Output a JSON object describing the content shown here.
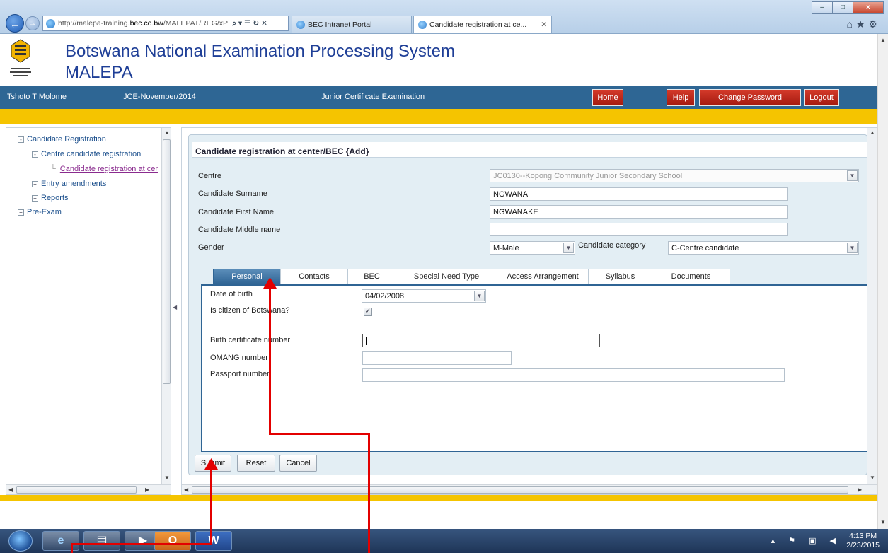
{
  "browser": {
    "url_prefix": "http://malepa-training.",
    "url_host": "bec.co.bw",
    "url_rest": "/MALEPAT/REG/xP",
    "url_tools": "⌕ ▾ ☰ ↻ ✕",
    "tabs": [
      {
        "label": "BEC Intranet Portal"
      },
      {
        "label": "Candidate registration at ce..."
      }
    ],
    "tab_close": "✕",
    "window_controls": {
      "minimize": "–",
      "maximize": "□",
      "close": "x"
    }
  },
  "header": {
    "title": "Botswana National Examination Processing System",
    "subtitle": "MALEPA"
  },
  "userbar": {
    "user_name": "Tshoto T Molome",
    "session": "JCE-November/2014",
    "exam": "Junior Certificate Examination",
    "home": "Home",
    "help": "Help",
    "change_password": "Change Password",
    "logout": "Logout"
  },
  "tree": {
    "items": [
      {
        "label": "Candidate Registration",
        "sign": "-"
      },
      {
        "label": "Centre candidate registration",
        "sign": "-"
      },
      {
        "label": "Candidate registration at cer"
      },
      {
        "label": "Entry amendments",
        "sign": "+"
      },
      {
        "label": "Reports",
        "sign": "+"
      },
      {
        "label": "Pre-Exam",
        "sign": "+"
      }
    ]
  },
  "form": {
    "title": "Candidate registration at center/BEC {Add}",
    "centre_label": "Centre",
    "centre_value": "JC0130--Kopong Community Junior Secondary School",
    "surname_label": "Candidate Surname",
    "surname_value": "NGWANA",
    "first_name_label": "Candidate First Name",
    "first_name_value": "NGWANAKE",
    "middle_name_label": "Candidate Middle name",
    "middle_name_value": "",
    "gender_label": "Gender",
    "gender_value": "M-Male",
    "category_label": "Candidate category",
    "category_value": "C-Centre candidate",
    "tabs": [
      "Personal",
      "Contacts",
      "BEC",
      "Special Need Type",
      "Access Arrangement",
      "Syllabus",
      "Documents"
    ],
    "personal": {
      "dob_label": "Date of birth",
      "dob_value": "04/02/2008",
      "citizen_label": "Is citizen of Botswana?",
      "citizen_checked": true,
      "birth_cert_label": "Birth certificate number",
      "birth_cert_value": "",
      "omang_label": "OMANG number",
      "omang_value": "",
      "passport_label": "Passport number",
      "passport_value": ""
    },
    "buttons": {
      "submit": "Submit",
      "reset": "Reset",
      "cancel": "Cancel"
    }
  },
  "taskbar": {
    "tray_icons": "▴ ⚑ ▣ ◀",
    "time": "4:13 PM",
    "date": "2/23/2015"
  },
  "colors": {
    "accent": "#2e6694",
    "title_blue": "#1f3f97",
    "yellow": "#f5c400",
    "danger": "#c62a1c",
    "annotation": "#e30000"
  }
}
